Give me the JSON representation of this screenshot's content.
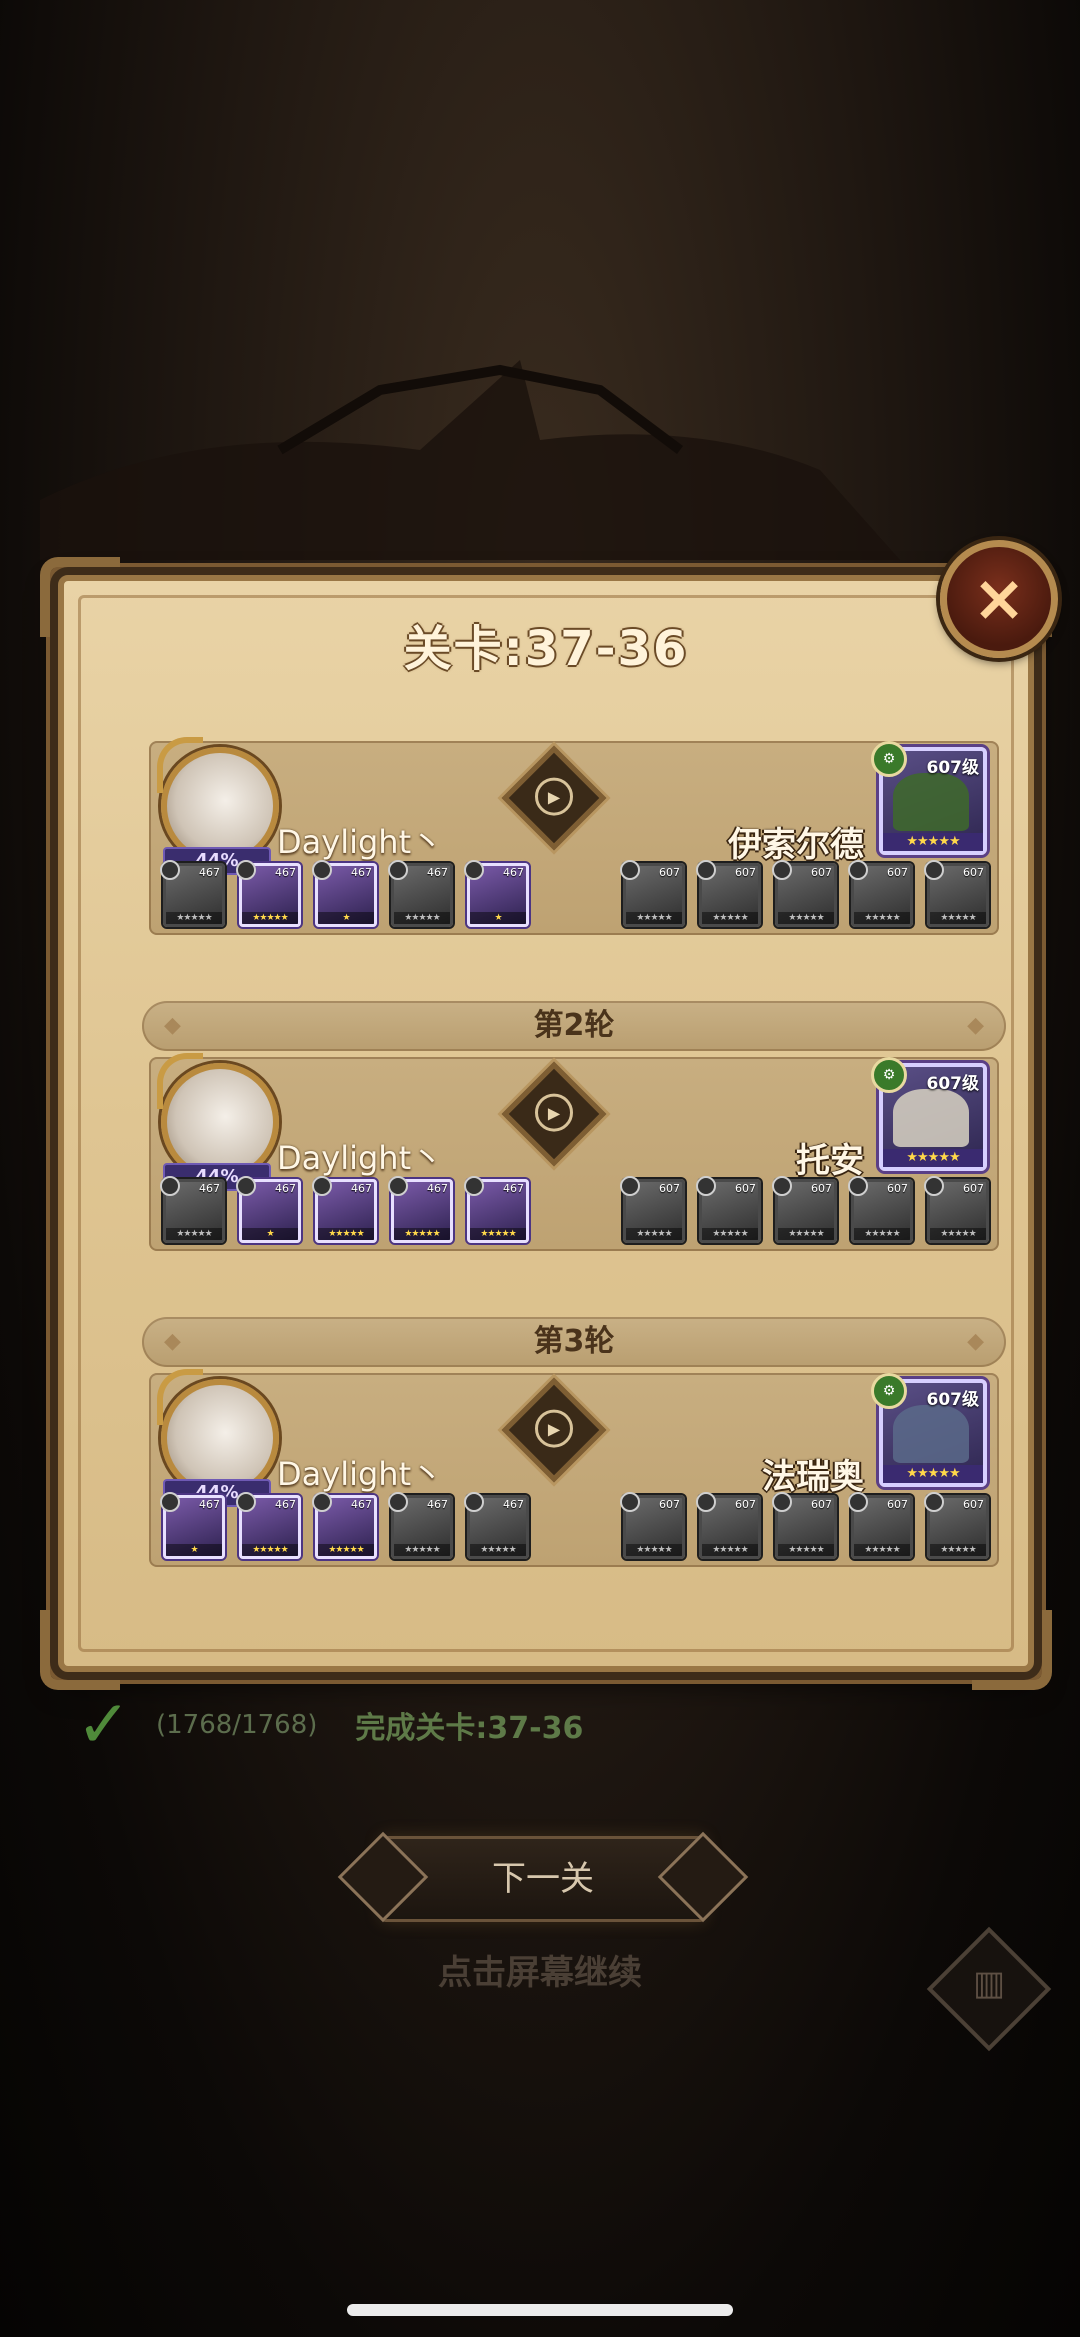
{
  "title": "关卡:37-36",
  "close_icon": "×",
  "rounds": [
    {
      "wave_label": "",
      "player": {
        "name": "Daylight丶",
        "percent": "44%",
        "team": [
          {
            "level": "467",
            "stars": "★★★★★",
            "colored": false
          },
          {
            "level": "467",
            "stars": "★★★★★",
            "colored": true
          },
          {
            "level": "467",
            "stars": "★",
            "colored": true
          },
          {
            "level": "467",
            "stars": "★★★★★",
            "colored": false
          },
          {
            "level": "467",
            "stars": "★",
            "colored": true
          }
        ]
      },
      "enemy": {
        "name": "伊索尔德",
        "boss_level": "607级",
        "boss_stars": "★★★★★",
        "boss_color": "#3e6a2a",
        "team": [
          "607",
          "607",
          "607",
          "607",
          "607"
        ]
      }
    },
    {
      "wave_label": "第2轮",
      "player": {
        "name": "Daylight丶",
        "percent": "44%",
        "team": [
          {
            "level": "467",
            "stars": "★★★★★",
            "colored": false
          },
          {
            "level": "467",
            "stars": "★",
            "colored": true
          },
          {
            "level": "467",
            "stars": "★★★★★",
            "colored": true
          },
          {
            "level": "467",
            "stars": "★★★★★",
            "colored": true
          },
          {
            "level": "467",
            "stars": "★★★★★",
            "colored": true
          }
        ]
      },
      "enemy": {
        "name": "托安",
        "boss_level": "607级",
        "boss_stars": "★★★★★",
        "boss_color": "#d8d2c2",
        "team": [
          "607",
          "607",
          "607",
          "607",
          "607"
        ]
      }
    },
    {
      "wave_label": "第3轮",
      "player": {
        "name": "Daylight丶",
        "percent": "44%",
        "team": [
          {
            "level": "467",
            "stars": "★",
            "colored": true
          },
          {
            "level": "467",
            "stars": "★★★★★",
            "colored": true
          },
          {
            "level": "467",
            "stars": "★★★★★",
            "colored": true
          },
          {
            "level": "467",
            "stars": "★★★★★",
            "colored": false
          },
          {
            "level": "467",
            "stars": "★★★★★",
            "colored": false
          }
        ]
      },
      "enemy": {
        "name": "法瑞奥",
        "boss_level": "607级",
        "boss_stars": "★★★★★",
        "boss_color": "#5a6a8a",
        "team": [
          "607",
          "607",
          "607",
          "607",
          "607"
        ]
      }
    }
  ],
  "result": {
    "count": "(1768/1768)",
    "text": "完成关卡:37-36"
  },
  "next_button": "下一关",
  "tap_hint": "点击屏幕继续",
  "stats_icon": "bar-chart-icon"
}
